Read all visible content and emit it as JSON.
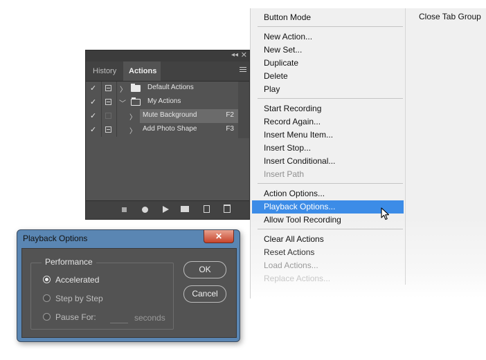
{
  "actions_panel": {
    "tabs": [
      {
        "label": "History"
      },
      {
        "label": "Actions"
      }
    ],
    "rows": [
      {
        "label": "Default Actions",
        "key": ""
      },
      {
        "label": "My Actions",
        "key": ""
      },
      {
        "label": "Mute Background",
        "key": "F2"
      },
      {
        "label": "Add Photo Shape",
        "key": "F3"
      }
    ],
    "collapse_glyph": "◂◂",
    "close_glyph": "✕"
  },
  "flyout_menu": {
    "items": [
      "Button Mode",
      "New Action...",
      "New Set...",
      "Duplicate",
      "Delete",
      "Play",
      "Start Recording",
      "Record Again...",
      "Insert Menu Item...",
      "Insert Stop...",
      "Insert Conditional...",
      "Insert Path",
      "Action Options...",
      "Playback Options...",
      "Allow Tool Recording",
      "Clear All Actions",
      "Reset Actions",
      "Load Actions...",
      "Replace Actions..."
    ],
    "close_tab_group": "Close Tab Group",
    "highlight_color": "#3c8ce7"
  },
  "dialog": {
    "title": "Playback Options",
    "close_glyph": "✕",
    "group_label": "Performance",
    "options": [
      "Accelerated",
      "Step by Step",
      "Pause For:"
    ],
    "selected_option": "Accelerated",
    "seconds_label": "seconds",
    "ok_label": "OK",
    "cancel_label": "Cancel"
  },
  "icons": {
    "check": "✓",
    "chevron_right": "〉",
    "chevron_down": "﹀"
  }
}
